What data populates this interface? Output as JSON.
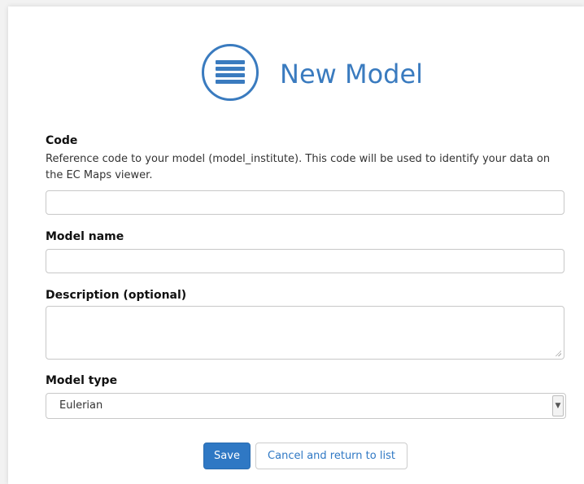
{
  "header": {
    "title": "New Model",
    "icon": "menu-lines-icon",
    "accent_color": "#3a7bbf"
  },
  "fields": {
    "code": {
      "label": "Code",
      "help": "Reference code to your model (model_institute). This code will be used to identify your data on the EC Maps viewer.",
      "value": ""
    },
    "model_name": {
      "label": "Model name",
      "value": ""
    },
    "description": {
      "label": "Description (optional)",
      "value": ""
    },
    "model_type": {
      "label": "Model type",
      "selected": "Eulerian"
    }
  },
  "actions": {
    "save_label": "Save",
    "cancel_label": "Cancel and return to list"
  }
}
